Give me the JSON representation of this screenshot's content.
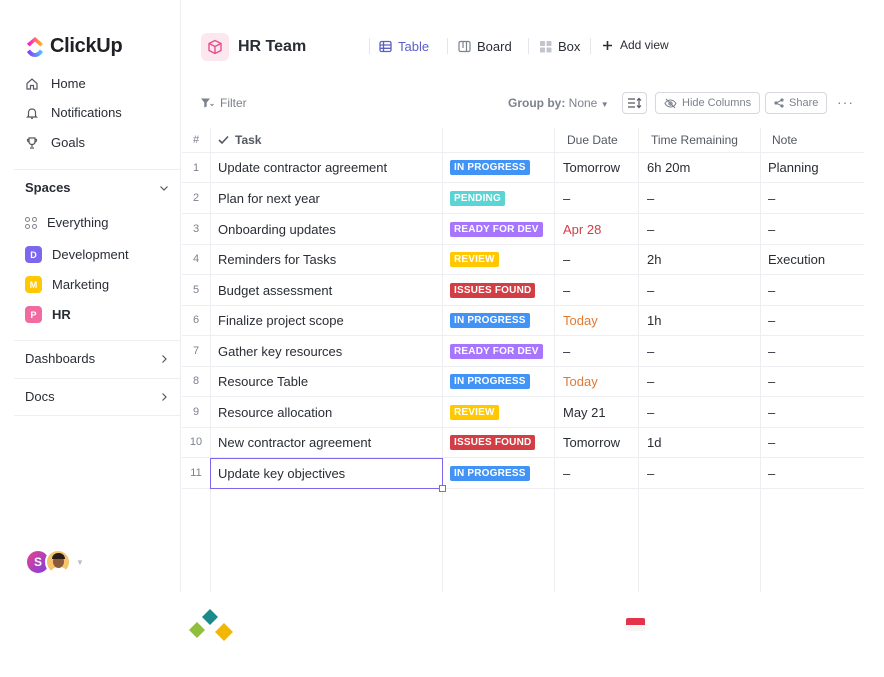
{
  "app": {
    "name": "ClickUp"
  },
  "sidebar": {
    "nav": [
      {
        "label": "Home",
        "icon": "home-icon"
      },
      {
        "label": "Notifications",
        "icon": "bell-icon"
      },
      {
        "label": "Goals",
        "icon": "trophy-icon"
      }
    ],
    "spaces_label": "Spaces",
    "everything_label": "Everything",
    "spaces": [
      {
        "letter": "D",
        "label": "Development",
        "color": "#7b68ee"
      },
      {
        "letter": "M",
        "label": "Marketing",
        "color": "#ffc800"
      },
      {
        "letter": "P",
        "label": "HR",
        "color": "#f26ba0"
      }
    ],
    "dashboards_label": "Dashboards",
    "docs_label": "Docs",
    "user_initial": "S"
  },
  "header": {
    "title": "HR Team",
    "tabs": [
      {
        "label": "Table",
        "icon": "table-icon",
        "active": true
      },
      {
        "label": "Board",
        "icon": "board-icon",
        "active": false
      },
      {
        "label": "Box",
        "icon": "box-icon",
        "active": false
      }
    ],
    "add_view_label": "Add view"
  },
  "toolbar": {
    "filter_label": "Filter",
    "groupby_label": "Group by:",
    "groupby_value": "None",
    "hide_columns_label": "Hide Columns",
    "share_label": "Share"
  },
  "table": {
    "columns": {
      "num": "#",
      "task": "Task",
      "status": "",
      "due": "Due Date",
      "time": "Time Remaining",
      "note": "Note"
    },
    "rows": [
      {
        "num": "1",
        "task": "Update contractor agreement",
        "status": "IN PROGRESS",
        "status_color": "#4194f6",
        "due": "Tomorrow",
        "due_style": "normal",
        "time": "6h 20m",
        "note": "Planning"
      },
      {
        "num": "2",
        "task": "Plan for next year",
        "status": "PENDING",
        "status_color": "#5cd4d4",
        "due": "–",
        "due_style": "normal",
        "time": "–",
        "note": "–"
      },
      {
        "num": "3",
        "task": "Onboarding updates",
        "status": "READY FOR DEV",
        "status_color": "#a875ff",
        "due": "Apr 28",
        "due_style": "red",
        "time": "–",
        "note": "–"
      },
      {
        "num": "4",
        "task": "Reminders for Tasks",
        "status": "REVIEW",
        "status_color": "#ffc800",
        "due": "–",
        "due_style": "normal",
        "time": "2h",
        "note": "Execution"
      },
      {
        "num": "5",
        "task": "Budget assessment",
        "status": "ISSUES FOUND",
        "status_color": "#d33d44",
        "due": "–",
        "due_style": "normal",
        "time": "–",
        "note": "–"
      },
      {
        "num": "6",
        "task": "Finalize project scope",
        "status": "IN PROGRESS",
        "status_color": "#4194f6",
        "due": "Today",
        "due_style": "orange",
        "time": "1h",
        "note": "–"
      },
      {
        "num": "7",
        "task": "Gather key resources",
        "status": "READY FOR DEV",
        "status_color": "#a875ff",
        "due": "–",
        "due_style": "normal",
        "time": "–",
        "note": "–"
      },
      {
        "num": "8",
        "task": "Resource Table",
        "status": "IN PROGRESS",
        "status_color": "#4194f6",
        "due": "Today",
        "due_style": "orange",
        "time": "–",
        "note": "–"
      },
      {
        "num": "9",
        "task": "Resource allocation",
        "status": "REVIEW",
        "status_color": "#ffc800",
        "due": "May 21",
        "due_style": "normal",
        "time": "–",
        "note": "–"
      },
      {
        "num": "10",
        "task": "New contractor agreement",
        "status": "ISSUES FOUND",
        "status_color": "#d33d44",
        "due": "Tomorrow",
        "due_style": "normal",
        "time": "1d",
        "note": "–"
      },
      {
        "num": "11",
        "task": "Update key objectives",
        "status": "IN PROGRESS",
        "status_color": "#4194f6",
        "due": "–",
        "due_style": "normal",
        "time": "–",
        "note": "–"
      }
    ]
  },
  "colors": {
    "accent": "#5b5fc7",
    "selection": "#7b68ee"
  }
}
